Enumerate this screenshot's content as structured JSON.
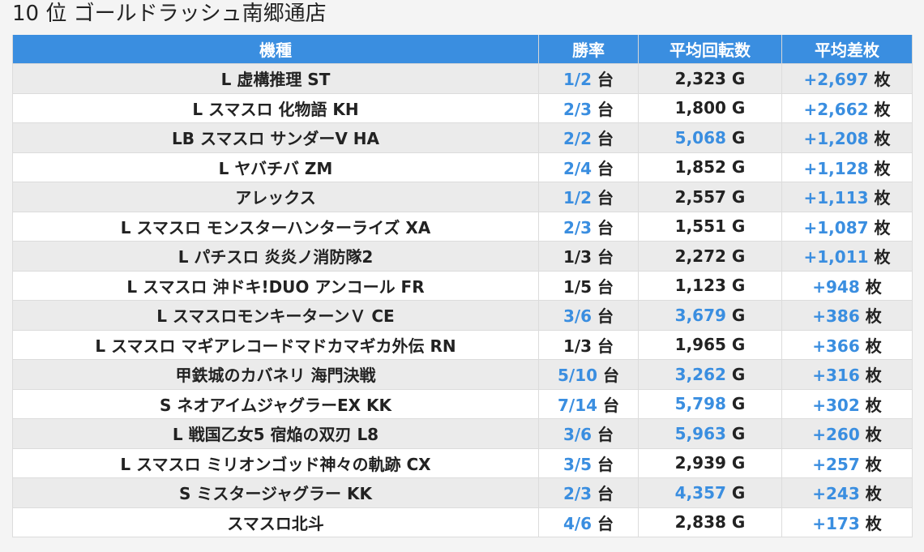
{
  "page_title": "10 位 ゴールドラッシュ南郷通店",
  "columns": [
    "機種",
    "勝率",
    "平均回転数",
    "平均差枚"
  ],
  "units": {
    "win": "台",
    "spins": "G",
    "diff": "枚"
  },
  "colors": {
    "header_bg": "#3a8ee0",
    "highlight": "#3a8ee0",
    "row_alt": "#ebebeb"
  },
  "rows": [
    {
      "machine": "L 虚構推理 ST",
      "win_rate": "1/2",
      "win_hl": true,
      "spins": "2,323",
      "spins_hl": false,
      "diff": "+2,697"
    },
    {
      "machine": "L スマスロ 化物語 KH",
      "win_rate": "2/3",
      "win_hl": true,
      "spins": "1,800",
      "spins_hl": false,
      "diff": "+2,662"
    },
    {
      "machine": "LB スマスロ サンダーV HA",
      "win_rate": "2/2",
      "win_hl": true,
      "spins": "5,068",
      "spins_hl": true,
      "diff": "+1,208"
    },
    {
      "machine": "L ヤバチバ ZM",
      "win_rate": "2/4",
      "win_hl": true,
      "spins": "1,852",
      "spins_hl": false,
      "diff": "+1,128"
    },
    {
      "machine": "アレックス",
      "win_rate": "1/2",
      "win_hl": true,
      "spins": "2,557",
      "spins_hl": false,
      "diff": "+1,113"
    },
    {
      "machine": "L スマスロ モンスターハンターライズ XA",
      "win_rate": "2/3",
      "win_hl": true,
      "spins": "1,551",
      "spins_hl": false,
      "diff": "+1,087"
    },
    {
      "machine": "L パチスロ 炎炎ノ消防隊2",
      "win_rate": "1/3",
      "win_hl": false,
      "spins": "2,272",
      "spins_hl": false,
      "diff": "+1,011"
    },
    {
      "machine": "L スマスロ 沖ドキ!DUO アンコール FR",
      "win_rate": "1/5",
      "win_hl": false,
      "spins": "1,123",
      "spins_hl": false,
      "diff": "+948"
    },
    {
      "machine": "L スマスロモンキーターンＶ CE",
      "win_rate": "3/6",
      "win_hl": true,
      "spins": "3,679",
      "spins_hl": true,
      "diff": "+386"
    },
    {
      "machine": "L スマスロ マギアレコードマドカマギカ外伝 RN",
      "win_rate": "1/3",
      "win_hl": false,
      "spins": "1,965",
      "spins_hl": false,
      "diff": "+366"
    },
    {
      "machine": "甲鉄城のカバネリ 海門決戦",
      "win_rate": "5/10",
      "win_hl": true,
      "spins": "3,262",
      "spins_hl": true,
      "diff": "+316"
    },
    {
      "machine": "S ネオアイムジャグラーEX KK",
      "win_rate": "7/14",
      "win_hl": true,
      "spins": "5,798",
      "spins_hl": true,
      "diff": "+302"
    },
    {
      "machine": "L 戦国乙女5 宿焔の双刃 L8",
      "win_rate": "3/6",
      "win_hl": true,
      "spins": "5,963",
      "spins_hl": true,
      "diff": "+260"
    },
    {
      "machine": "L スマスロ ミリオンゴッド神々の軌跡 CX",
      "win_rate": "3/5",
      "win_hl": true,
      "spins": "2,939",
      "spins_hl": false,
      "diff": "+257"
    },
    {
      "machine": "S ミスタージャグラー KK",
      "win_rate": "2/3",
      "win_hl": true,
      "spins": "4,357",
      "spins_hl": true,
      "diff": "+243"
    },
    {
      "machine": "スマスロ北斗",
      "win_rate": "4/6",
      "win_hl": true,
      "spins": "2,838",
      "spins_hl": false,
      "diff": "+173"
    }
  ]
}
